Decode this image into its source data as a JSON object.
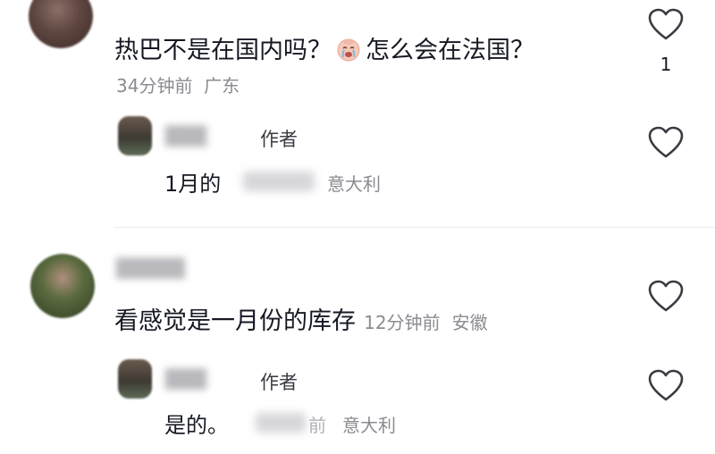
{
  "comments": [
    {
      "text_before_emoji": "热巴不是在国内吗？",
      "text_after_emoji": "怎么会在法国？",
      "emoji": "crying-face-emoji",
      "time": "34分钟前",
      "location": "广东",
      "likes": "1",
      "reply": {
        "author_tag": "作者",
        "text": "1月的",
        "location": "意大利"
      }
    },
    {
      "text": "看感觉是一月份的库存",
      "time": "12分钟前",
      "location": "安徽",
      "reply": {
        "author_tag": "作者",
        "text": "是的。",
        "time_fragment": "前",
        "location": "意大利"
      }
    }
  ],
  "icons": {
    "like": "heart-outline-icon"
  },
  "colors": {
    "text": "#161823",
    "meta": "#8a8b91",
    "icon": "#3a3b42"
  }
}
